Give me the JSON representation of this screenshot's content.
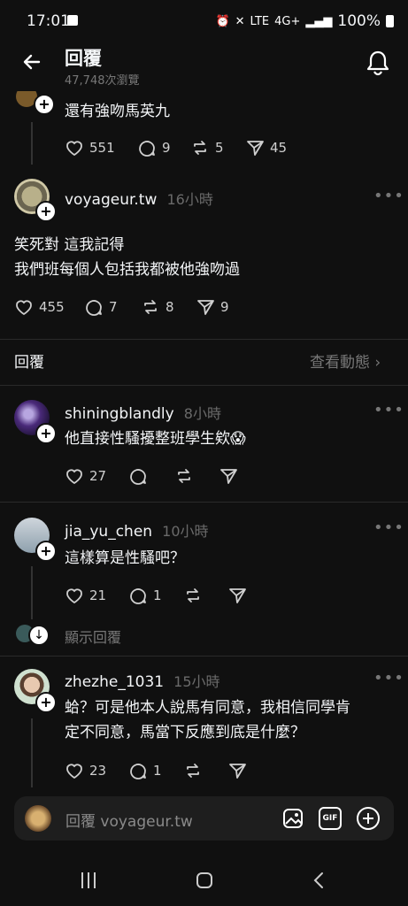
{
  "status": {
    "time": "17:01",
    "battery": "100%"
  },
  "header": {
    "title": "回覆",
    "views": "47,748次瀏覽"
  },
  "reply0": {
    "text": "還有強吻馬英九",
    "likes": "551",
    "comments": "9",
    "reposts": "5",
    "shares": "45"
  },
  "reply1": {
    "user": "voyageur.tw",
    "time": "16小時",
    "line1": "笑死對 這我記得",
    "line2": "我們班每個人包括我都被他強吻過",
    "likes": "455",
    "comments": "7",
    "reposts": "8",
    "shares": "9"
  },
  "section": {
    "left": "回覆",
    "right": "查看動態"
  },
  "reply2": {
    "user": "shiningblandly",
    "time": "8小時",
    "text": "他直接性騷擾整班學生欸😱",
    "likes": "27"
  },
  "reply3": {
    "user": "jia_yu_chen",
    "time": "10小時",
    "text": "這樣算是性騷吧？",
    "likes": "21",
    "comments": "1"
  },
  "showReplies": "顯示回覆",
  "reply4": {
    "user": "zhezhe_1031",
    "time": "15小時",
    "line1": "蛤？可是他本人說馬有同意，我相信同學肯",
    "line2": "定不同意，馬當下反應到底是什麼？",
    "likes": "23",
    "comments": "1"
  },
  "compose": {
    "placeholder": "回覆 voyageur.tw"
  },
  "icons": {
    "back": "back-arrow-icon",
    "bell": "bell-icon",
    "heart": "heart-icon",
    "comment": "comment-icon",
    "repost": "repost-icon",
    "share": "share-icon",
    "image": "image-icon",
    "gif": "gif-icon",
    "add": "add-icon"
  }
}
